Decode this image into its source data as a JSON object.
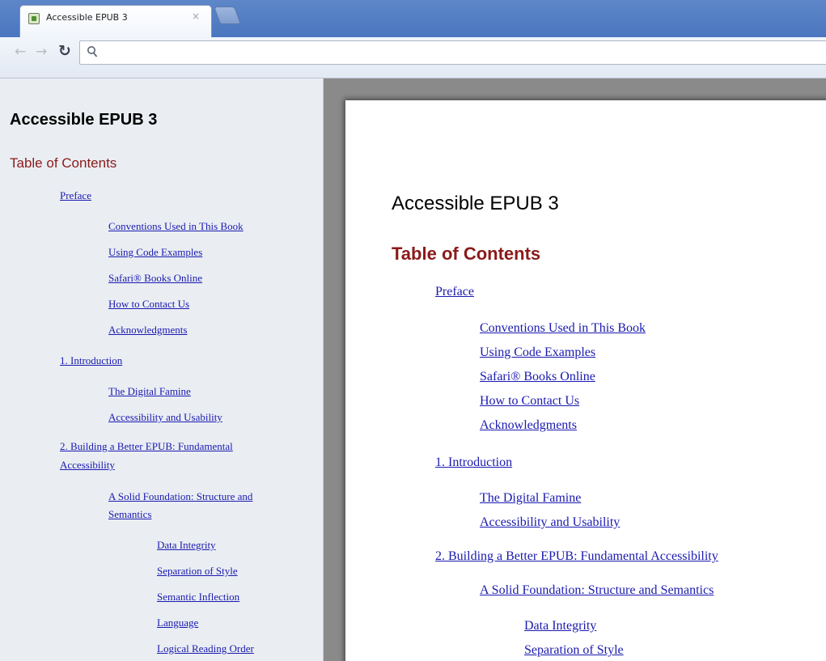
{
  "browser": {
    "tab_title": "Accessible EPUB 3",
    "tab_close": "×",
    "omnibox_value": ""
  },
  "document": {
    "title": "Accessible EPUB 3",
    "toc_heading": "Table of Contents",
    "toc": [
      {
        "label": "Preface",
        "level": 1
      },
      {
        "label": "Conventions Used in This Book",
        "level": 2
      },
      {
        "label": "Using Code Examples",
        "level": 2
      },
      {
        "label": "Safari® Books Online",
        "level": 2
      },
      {
        "label": "How to Contact Us",
        "level": 2
      },
      {
        "label": "Acknowledgments",
        "level": 2
      },
      {
        "label": "1. Introduction",
        "level": 1
      },
      {
        "label": "The Digital Famine",
        "level": 2
      },
      {
        "label": "Accessibility and Usability",
        "level": 2
      },
      {
        "label": "2. Building a Better EPUB: Fundamental Accessibility",
        "level": 1
      },
      {
        "label": "A Solid Foundation: Structure and Semantics",
        "level": 2
      },
      {
        "label": "Data Integrity",
        "level": 3
      },
      {
        "label": "Separation of Style",
        "level": 3
      },
      {
        "label": "Semantic Inflection",
        "level": 3
      },
      {
        "label": "Language",
        "level": 3
      },
      {
        "label": "Logical Reading Order",
        "level": 3
      }
    ],
    "sidebar_wrap": {
      "chapter2_line1": "2. Building a Better EPUB: Fundamental",
      "chapter2_line2": "Accessibility",
      "solid_line1": "A Solid Foundation: Structure and",
      "solid_line2": "Semantics"
    }
  },
  "colors": {
    "toc_heading": "#8b1a1a",
    "link": "#1a1ab0",
    "sidebar_bg": "#eaeef2",
    "viewer_bg": "#8a8a8a"
  },
  "icons": {
    "back": "back-arrow-icon",
    "forward": "forward-arrow-icon",
    "reload": "reload-icon",
    "search": "search-icon",
    "favicon": "epub-favicon-icon"
  }
}
